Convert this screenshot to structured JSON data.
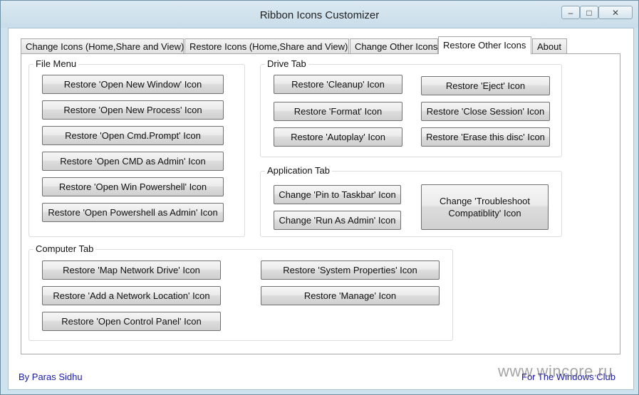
{
  "window": {
    "title": "Ribbon Icons Customizer"
  },
  "titlebar_buttons": {
    "minimize": "–",
    "maximize": "□",
    "close": "✕"
  },
  "tabs": [
    {
      "label": "Change Icons (Home,Share and View)"
    },
    {
      "label": "Restore Icons (Home,Share and View)"
    },
    {
      "label": "Change Other Icons"
    },
    {
      "label": "Restore Other Icons",
      "active": true
    },
    {
      "label": "About"
    }
  ],
  "file_menu": {
    "title": "File Menu",
    "buttons": [
      "Restore 'Open New Window' Icon",
      "Restore 'Open New Process' Icon",
      "Restore 'Open Cmd.Prompt' Icon",
      "Restore 'Open CMD as Admin' Icon",
      "Restore 'Open Win Powershell' Icon",
      "Restore 'Open Powershell as Admin' Icon"
    ]
  },
  "drive_tab": {
    "title": "Drive Tab",
    "buttons": [
      "Restore 'Cleanup' Icon",
      "Restore 'Eject' Icon",
      "Restore 'Format' Icon",
      "Restore 'Close Session' Icon",
      "Restore 'Autoplay' Icon",
      "Restore 'Erase this disc' Icon"
    ]
  },
  "application_tab": {
    "title": "Application Tab",
    "buttons": [
      "Change 'Pin to Taskbar' Icon",
      "Change 'Run As Admin' Icon",
      "Change 'Troubleshoot Compatiblity' Icon"
    ]
  },
  "computer_tab": {
    "title": "Computer Tab",
    "buttons": [
      "Restore 'Map Network Drive' Icon",
      "Restore 'System Properties' Icon",
      "Restore 'Add a Network Location' Icon",
      "Restore 'Manage' Icon",
      "Restore 'Open Control Panel' Icon"
    ]
  },
  "footer": {
    "author": "By Paras Sidhu",
    "credit": "For The Windows Club"
  },
  "watermark": "www.wincore.ru"
}
